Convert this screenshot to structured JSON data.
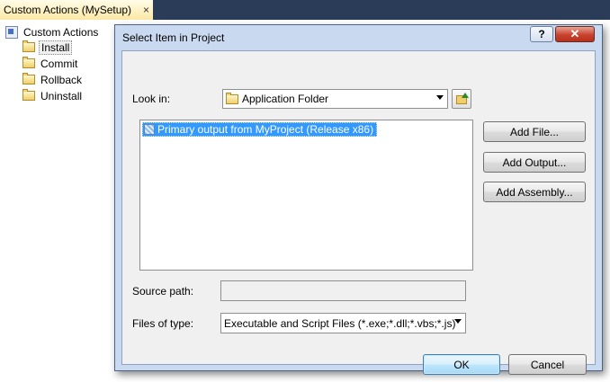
{
  "ide": {
    "tab_title": "Custom Actions (MySetup)",
    "tab_close": "×",
    "tree": {
      "root": "Custom Actions",
      "items": [
        "Install",
        "Commit",
        "Rollback",
        "Uninstall"
      ],
      "selected": "Install"
    }
  },
  "dialog": {
    "title": "Select Item in Project",
    "help_glyph": "?",
    "close_glyph": "✕",
    "look_in_label": "Look in:",
    "look_in_value": "Application Folder",
    "list_items": [
      "Primary output from MyProject (Release x86)"
    ],
    "buttons": {
      "add_file": "Add File...",
      "add_output": "Add Output...",
      "add_assembly": "Add Assembly...",
      "ok": "OK",
      "cancel": "Cancel"
    },
    "source_path_label": "Source path:",
    "source_path_value": "",
    "files_of_type_label": "Files of type:",
    "files_of_type_value": "Executable and Script Files (*.exe;*.dll;*.vbs;*.js)"
  }
}
